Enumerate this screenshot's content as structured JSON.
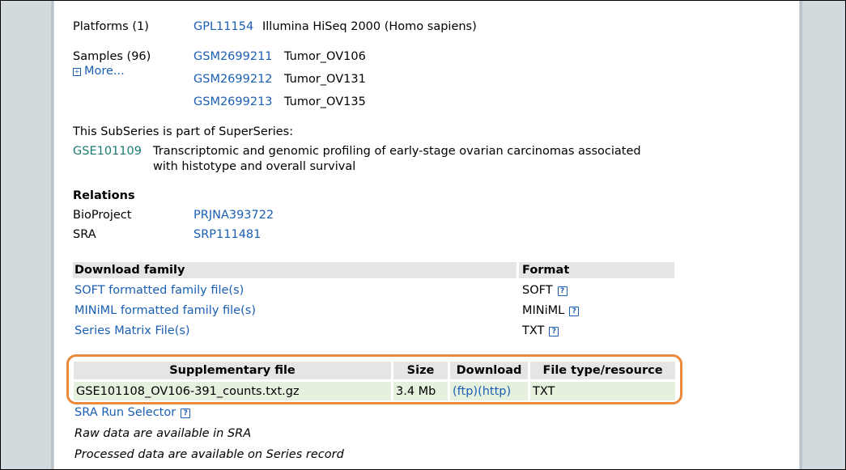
{
  "platforms": {
    "label": "Platforms (1)",
    "items": [
      {
        "id": "GPL11154",
        "desc": "Illumina HiSeq 2000 (Homo sapiens)"
      }
    ]
  },
  "samples": {
    "label": "Samples (96)",
    "more_label": "More...",
    "items": [
      {
        "id": "GSM2699211",
        "desc": "Tumor_OV106"
      },
      {
        "id": "GSM2699212",
        "desc": "Tumor_OV131"
      },
      {
        "id": "GSM2699213",
        "desc": "Tumor_OV135"
      }
    ]
  },
  "superseries": {
    "intro": "This SubSeries is part of SuperSeries:",
    "id": "GSE101109",
    "desc_line1": "Transcriptomic and genomic profiling of early-stage ovarian carcinomas associated",
    "desc_line2": "with histotype and overall survival"
  },
  "relations": {
    "title": "Relations",
    "items": [
      {
        "label": "BioProject",
        "value": "PRJNA393722"
      },
      {
        "label": "SRA",
        "value": "SRP111481"
      }
    ]
  },
  "download_family": {
    "header": "Download family",
    "format_header": "Format",
    "rows": [
      {
        "label": "SOFT formatted family file(s)",
        "format": "SOFT"
      },
      {
        "label": "MINiML formatted family file(s)",
        "format": "MINiML"
      },
      {
        "label": "Series Matrix File(s)",
        "format": "TXT"
      }
    ],
    "help_glyph": "?"
  },
  "supplementary": {
    "headers": [
      "Supplementary file",
      "Size",
      "Download",
      "File type/resource"
    ],
    "row": {
      "file": "GSE101108_OV106-391_counts.txt.gz",
      "size": "3.4 Mb",
      "ftp": "(ftp)",
      "http": "(http)",
      "type": "TXT"
    },
    "highlight_color": "#e98a3c"
  },
  "footer": {
    "sra_selector": "SRA Run Selector",
    "raw_note": "Raw data are available in SRA",
    "processed_note": "Processed data are available on Series record"
  }
}
